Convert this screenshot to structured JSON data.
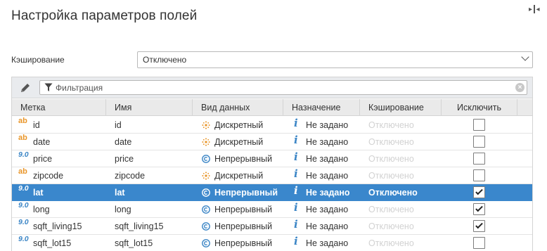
{
  "page": {
    "title": "Настройка параметров полей"
  },
  "caching": {
    "label": "Кэширование",
    "selected": "Отключено"
  },
  "filter": {
    "placeholder": "Фильтрация"
  },
  "table": {
    "columns": [
      "Метка",
      "Имя",
      "Вид данных",
      "Назначение",
      "Кэширование",
      "Исключить"
    ],
    "rows": [
      {
        "type": "ab",
        "label": "id",
        "name": "id",
        "kind_icon": "discrete-icon",
        "kind": "Дискретный",
        "purpose": "Не задано",
        "cache": "Отключено",
        "excluded": false,
        "selected": false
      },
      {
        "type": "ab",
        "label": "date",
        "name": "date",
        "kind_icon": "discrete-icon",
        "kind": "Дискретный",
        "purpose": "Не задано",
        "cache": "Отключено",
        "excluded": false,
        "selected": false
      },
      {
        "type": "9.0",
        "label": "price",
        "name": "price",
        "kind_icon": "continuous-icon",
        "kind": "Непрерывный",
        "purpose": "Не задано",
        "cache": "Отключено",
        "excluded": false,
        "selected": false
      },
      {
        "type": "ab",
        "label": "zipcode",
        "name": "zipcode",
        "kind_icon": "discrete-icon",
        "kind": "Дискретный",
        "purpose": "Не задано",
        "cache": "Отключено",
        "excluded": false,
        "selected": false
      },
      {
        "type": "9.0",
        "label": "lat",
        "name": "lat",
        "kind_icon": "continuous-icon",
        "kind": "Непрерывный",
        "purpose": "Не задано",
        "cache": "Отключено",
        "excluded": true,
        "selected": true
      },
      {
        "type": "9.0",
        "label": "long",
        "name": "long",
        "kind_icon": "continuous-icon",
        "kind": "Непрерывный",
        "purpose": "Не задано",
        "cache": "Отключено",
        "excluded": true,
        "selected": false
      },
      {
        "type": "9.0",
        "label": "sqft_living15",
        "name": "sqft_living15",
        "kind_icon": "continuous-icon",
        "kind": "Непрерывный",
        "purpose": "Не задано",
        "cache": "Отключено",
        "excluded": true,
        "selected": false
      },
      {
        "type": "9.0",
        "label": "sqft_lot15",
        "name": "sqft_lot15",
        "kind_icon": "continuous-icon",
        "kind": "Непрерывный",
        "purpose": "Не задано",
        "cache": "Отключено",
        "excluded": false,
        "selected": false
      }
    ]
  },
  "colors": {
    "selection": "#3a87cc",
    "discrete": "#e9962a",
    "continuous": "#3c86c6"
  }
}
